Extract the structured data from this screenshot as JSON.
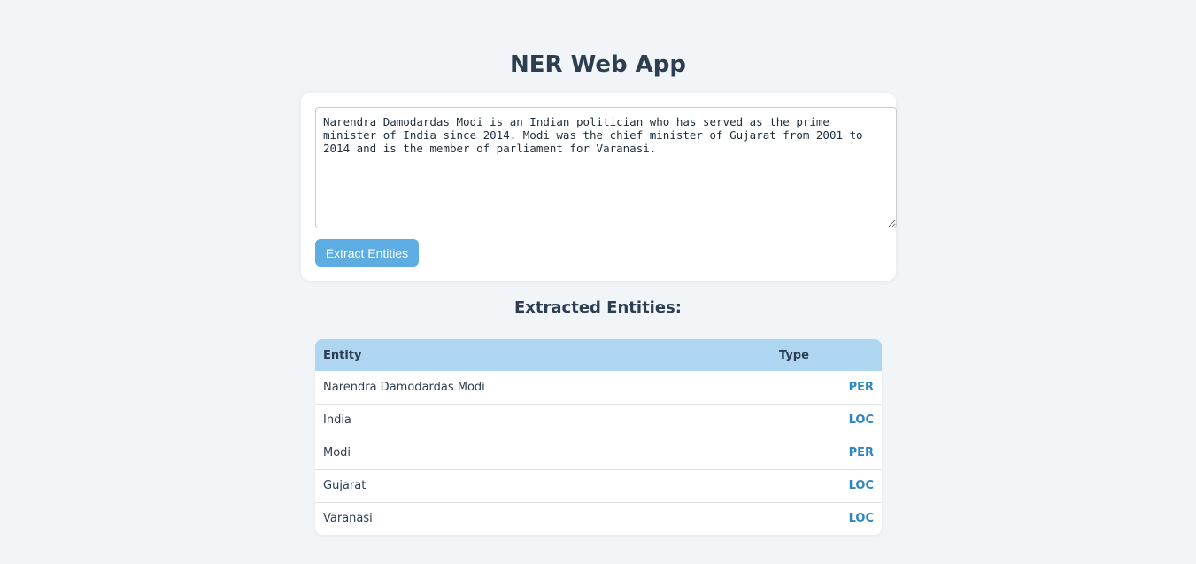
{
  "app": {
    "title": "NER Web App"
  },
  "input": {
    "text": "Narendra Damodardas Modi is an Indian politician who has served as the prime minister of India since 2014. Modi was the chief minister of Gujarat from 2001 to 2014 and is the member of parliament for Varanasi."
  },
  "actions": {
    "extract_label": "Extract Entities"
  },
  "results": {
    "heading": "Extracted Entities:",
    "columns": {
      "entity": "Entity",
      "type": "Type"
    },
    "rows": [
      {
        "entity": "Narendra Damodardas Modi",
        "type": "PER"
      },
      {
        "entity": "India",
        "type": "LOC"
      },
      {
        "entity": "Modi",
        "type": "PER"
      },
      {
        "entity": "Gujarat",
        "type": "LOC"
      },
      {
        "entity": "Varanasi",
        "type": "LOC"
      }
    ]
  },
  "colors": {
    "background": "#f1f5f8",
    "button": "#5dade2",
    "table_header": "#aed6f1",
    "entity_type": "#2e86c1",
    "heading_text": "#2c3e50"
  }
}
